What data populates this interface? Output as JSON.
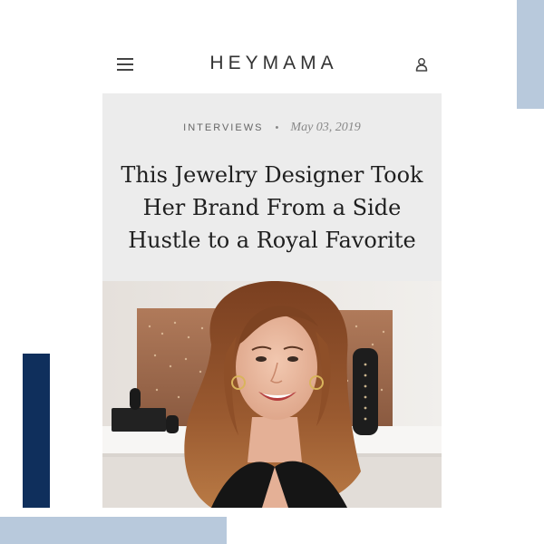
{
  "header": {
    "logo": "HEYMAMA"
  },
  "article": {
    "category": "INTERVIEWS",
    "separator": "•",
    "date": "May 03, 2019",
    "headline": "This Jewelry Designer Took Her Brand From a Side Hustle to a Royal Favorite"
  },
  "icons": {
    "menu": "hamburger-menu-icon",
    "user": "user-icon"
  },
  "colors": {
    "deco_light_blue": "#b8c9dc",
    "deco_navy": "#0f2f5c",
    "card_background": "#ececec"
  }
}
